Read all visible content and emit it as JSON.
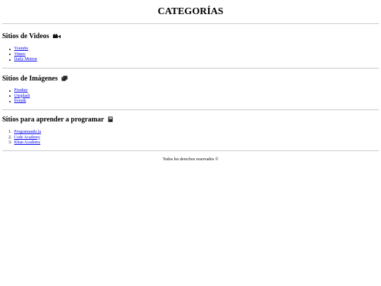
{
  "page_title": "CATEGORÍAS",
  "sections": [
    {
      "title": "Sitios de Videos",
      "icon": "video-camera-icon",
      "list_type": "unordered",
      "links": [
        "Youtube",
        "Vimeo",
        "Daily Motion"
      ]
    },
    {
      "title": "Sitios de Imágenes",
      "icon": "images-icon",
      "list_type": "unordered",
      "links": [
        "Pixabay",
        "Unsplash",
        "freepik"
      ]
    },
    {
      "title": "Sitios para aprender a programar",
      "icon": "book-icon",
      "list_type": "ordered",
      "numbers": [
        "1.",
        "2.",
        "3."
      ],
      "links": [
        "Programando.la",
        "Code Academy",
        "Khan Academy"
      ]
    }
  ],
  "footer": "Todos los derechos reservados ©",
  "colors": {
    "link": "#0000ee",
    "rule": "#c9c9c9",
    "text": "#000000"
  }
}
